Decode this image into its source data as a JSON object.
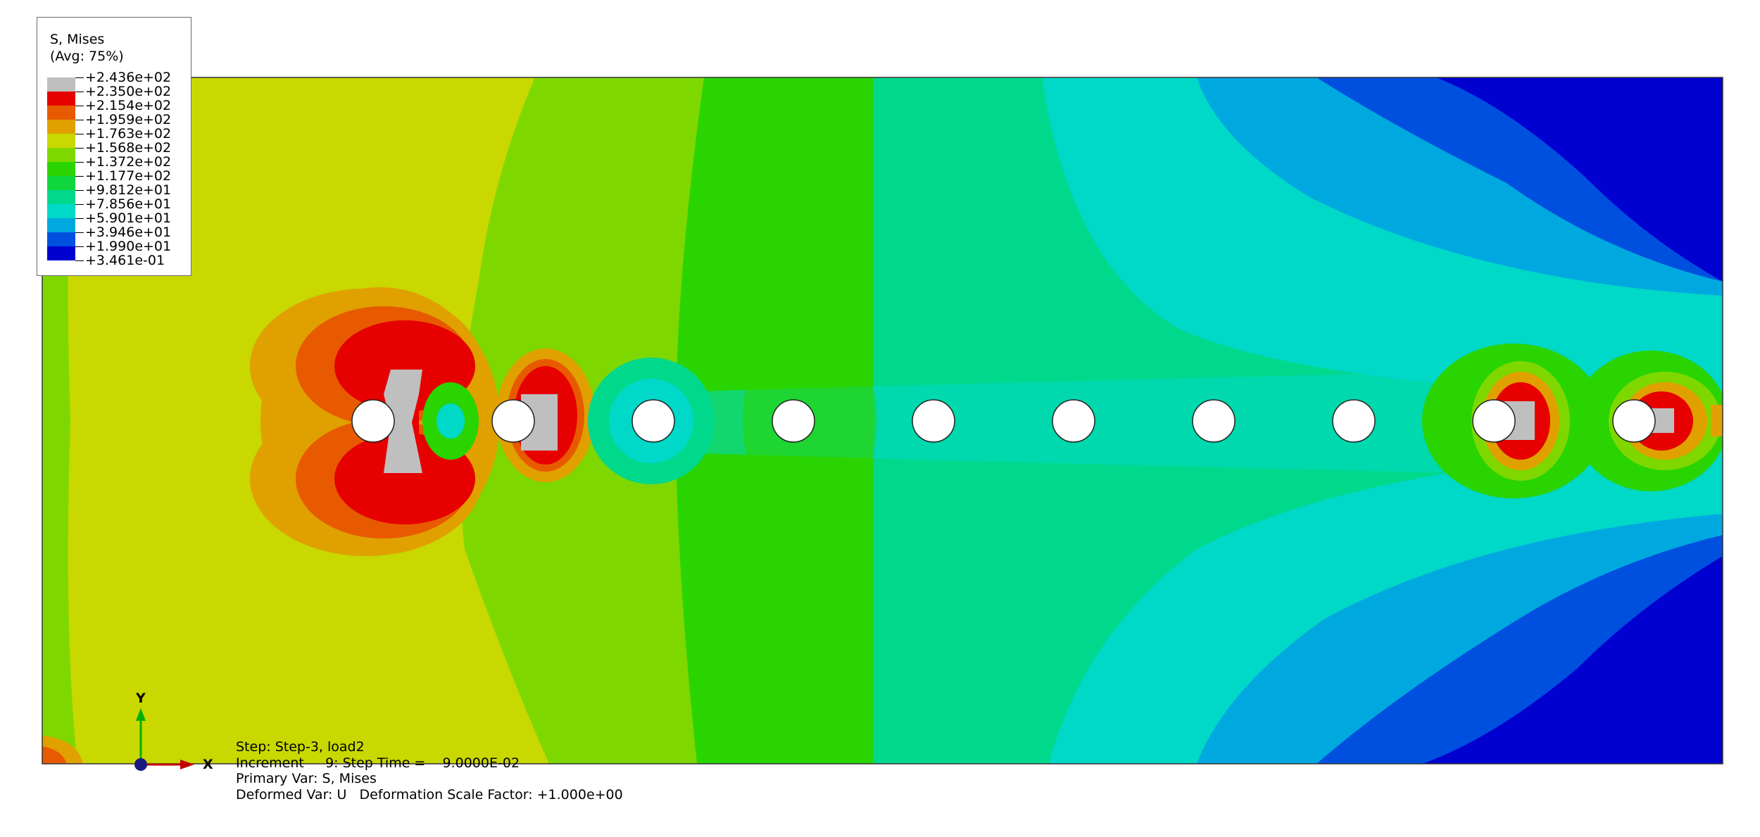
{
  "legend": {
    "title": "S, Mises",
    "subtitle": "(Avg: 75%)",
    "ticks": [
      "+2.436e+02",
      "+2.350e+02",
      "+2.154e+02",
      "+1.959e+02",
      "+1.763e+02",
      "+1.568e+02",
      "+1.372e+02",
      "+1.177e+02",
      "+9.812e+01",
      "+7.856e+01",
      "+5.901e+01",
      "+3.946e+01",
      "+1.990e+01",
      "+3.461e-01"
    ],
    "colors": [
      "#bfbfbf",
      "#e60000",
      "#e85a00",
      "#e0a000",
      "#c8d800",
      "#7ed800",
      "#29d400",
      "#0ed63c",
      "#00d88c",
      "#00d8c8",
      "#00a8e0",
      "#0050e0",
      "#0000d0"
    ]
  },
  "info": {
    "step_line": "Step: Step-3, load2",
    "increment_line": "Increment     9: Step Time =    9.0000E-02",
    "primary_var_line": "Primary Var: S, Mises",
    "deformed_var_line": "Deformed Var: U   Deformation Scale Factor: +1.000e+00"
  },
  "triad": {
    "y_label": "Y",
    "x_label": "X"
  },
  "holes": {
    "count": 10
  }
}
